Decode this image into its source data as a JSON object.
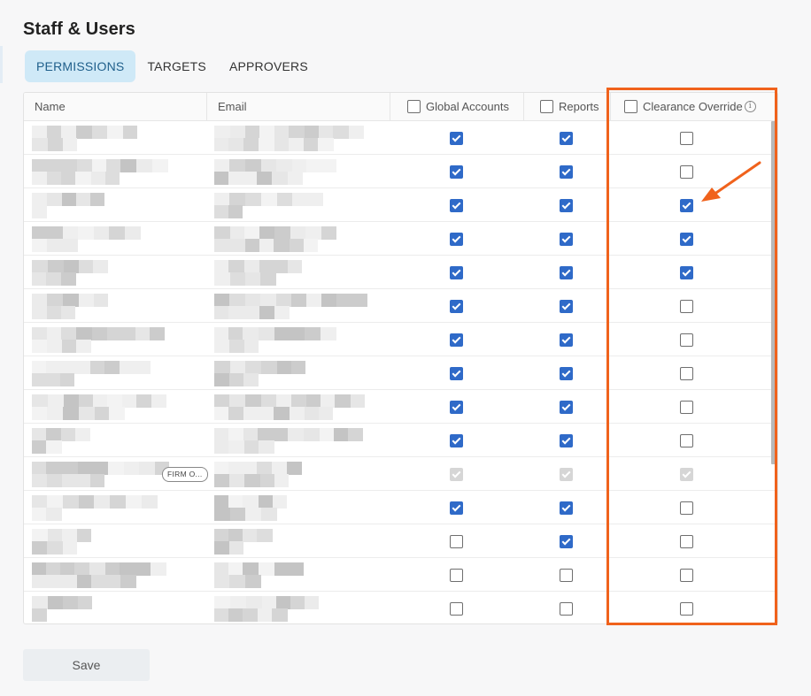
{
  "page": {
    "title": "Staff & Users"
  },
  "tabs": [
    {
      "label": "PERMISSIONS",
      "active": true
    },
    {
      "label": "TARGETS",
      "active": false
    },
    {
      "label": "APPROVERS",
      "active": false
    }
  ],
  "table": {
    "columns": {
      "name": "Name",
      "email": "Email",
      "global_accounts": "Global Accounts",
      "reports": "Reports",
      "clearance_override": "Clearance Override"
    },
    "info_icon": "info-icon",
    "rows": [
      {
        "global": "checked",
        "reports": "checked",
        "clearance": "unchecked"
      },
      {
        "global": "checked",
        "reports": "checked",
        "clearance": "unchecked"
      },
      {
        "global": "checked",
        "reports": "checked",
        "clearance": "checked"
      },
      {
        "global": "checked",
        "reports": "checked",
        "clearance": "checked"
      },
      {
        "global": "checked",
        "reports": "checked",
        "clearance": "checked"
      },
      {
        "global": "checked",
        "reports": "checked",
        "clearance": "unchecked"
      },
      {
        "global": "checked",
        "reports": "checked",
        "clearance": "unchecked"
      },
      {
        "global": "checked",
        "reports": "checked",
        "clearance": "unchecked"
      },
      {
        "global": "checked",
        "reports": "checked",
        "clearance": "unchecked"
      },
      {
        "global": "checked",
        "reports": "checked",
        "clearance": "unchecked"
      },
      {
        "global": "disabled",
        "reports": "disabled",
        "clearance": "disabled",
        "chip": "FIRM O..."
      },
      {
        "global": "checked",
        "reports": "checked",
        "clearance": "unchecked"
      },
      {
        "global": "unchecked",
        "reports": "checked",
        "clearance": "unchecked"
      },
      {
        "global": "unchecked",
        "reports": "unchecked",
        "clearance": "unchecked"
      },
      {
        "global": "unchecked",
        "reports": "unchecked",
        "clearance": "unchecked"
      }
    ]
  },
  "annotation": {
    "highlight_color": "#f0621c",
    "arrow_icon": "arrow-icon"
  },
  "footer": {
    "save_label": "Save"
  }
}
